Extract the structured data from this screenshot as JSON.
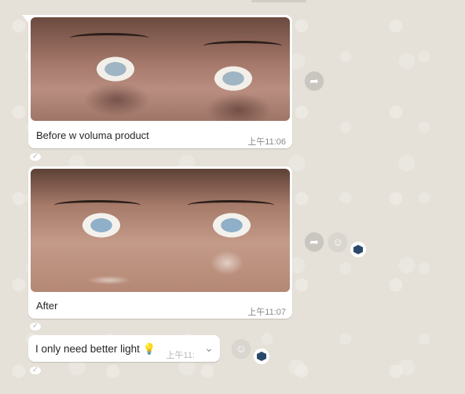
{
  "messages": [
    {
      "type": "image",
      "caption": "Before w voluma product",
      "time": "上午11:06"
    },
    {
      "type": "image",
      "caption": "After",
      "time": "上午11:07"
    },
    {
      "type": "text",
      "text": "I only need better light",
      "emoji": "💡",
      "time": "上午11:"
    }
  ],
  "icons": {
    "forward": "forward-icon",
    "emoji_reaction": "emoji-reaction-icon",
    "app_badge": "app-badge-icon",
    "menu_chevron": "chevron-down-icon",
    "read_check": "check-icon"
  },
  "colors": {
    "background": "#e6e1d9",
    "bubble": "#ffffff",
    "badge": "#2b4a69"
  }
}
